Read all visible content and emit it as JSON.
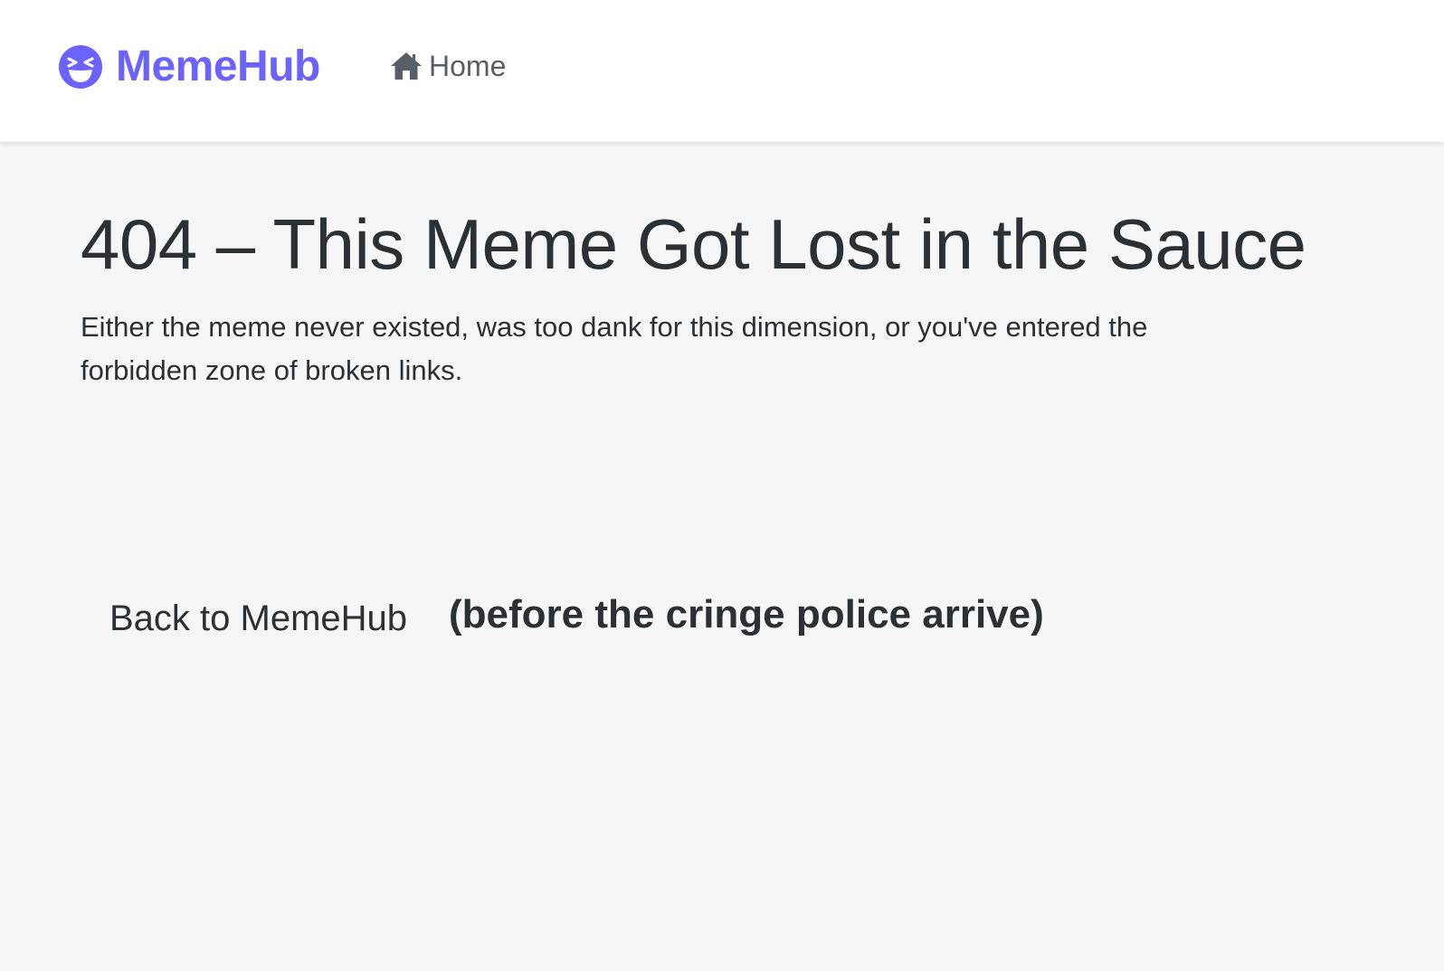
{
  "colors": {
    "brand": "#6c63ff",
    "nav_text": "#595f66",
    "text": "#2b3035",
    "background": "#f6f6f6",
    "navbar_background": "#ffffff"
  },
  "navbar": {
    "brand": {
      "icon": "laughing-face-icon",
      "name": "MemeHub"
    },
    "links": [
      {
        "icon": "home-icon",
        "label": "Home"
      }
    ]
  },
  "main": {
    "title": "404 – This Meme Got Lost in the Sauce",
    "description": "Either the meme never existed, was too dank for this dimension, or you've entered the forbidden zone of broken links.",
    "back_button_label": "Back to MemeHub",
    "note": "(before the cringe police arrive)"
  }
}
